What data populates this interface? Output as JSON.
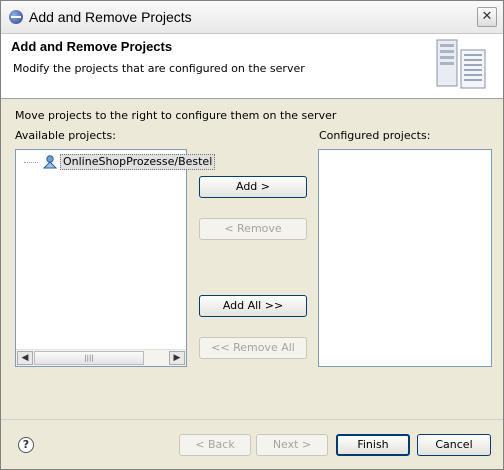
{
  "window": {
    "title": "Add and Remove Projects",
    "close_symbol": "✕"
  },
  "header": {
    "title": "Add and Remove Projects",
    "description": "Modify the projects that are configured on the server"
  },
  "instructions": "Move projects to the right to configure them on the server",
  "available": {
    "label": "Available projects:",
    "items": [
      {
        "label": "OnlineShopProzesse/Bestel"
      }
    ],
    "scroll_left": "◀",
    "scroll_right": "▶",
    "thumb_grip": "||||"
  },
  "configured": {
    "label": "Configured projects:",
    "items": []
  },
  "buttons": {
    "add": "Add >",
    "remove": "< Remove",
    "add_all": "Add All >>",
    "remove_all": "<< Remove All"
  },
  "footer": {
    "help": "?",
    "back": "< Back",
    "next": "Next >",
    "finish": "Finish",
    "cancel": "Cancel"
  }
}
